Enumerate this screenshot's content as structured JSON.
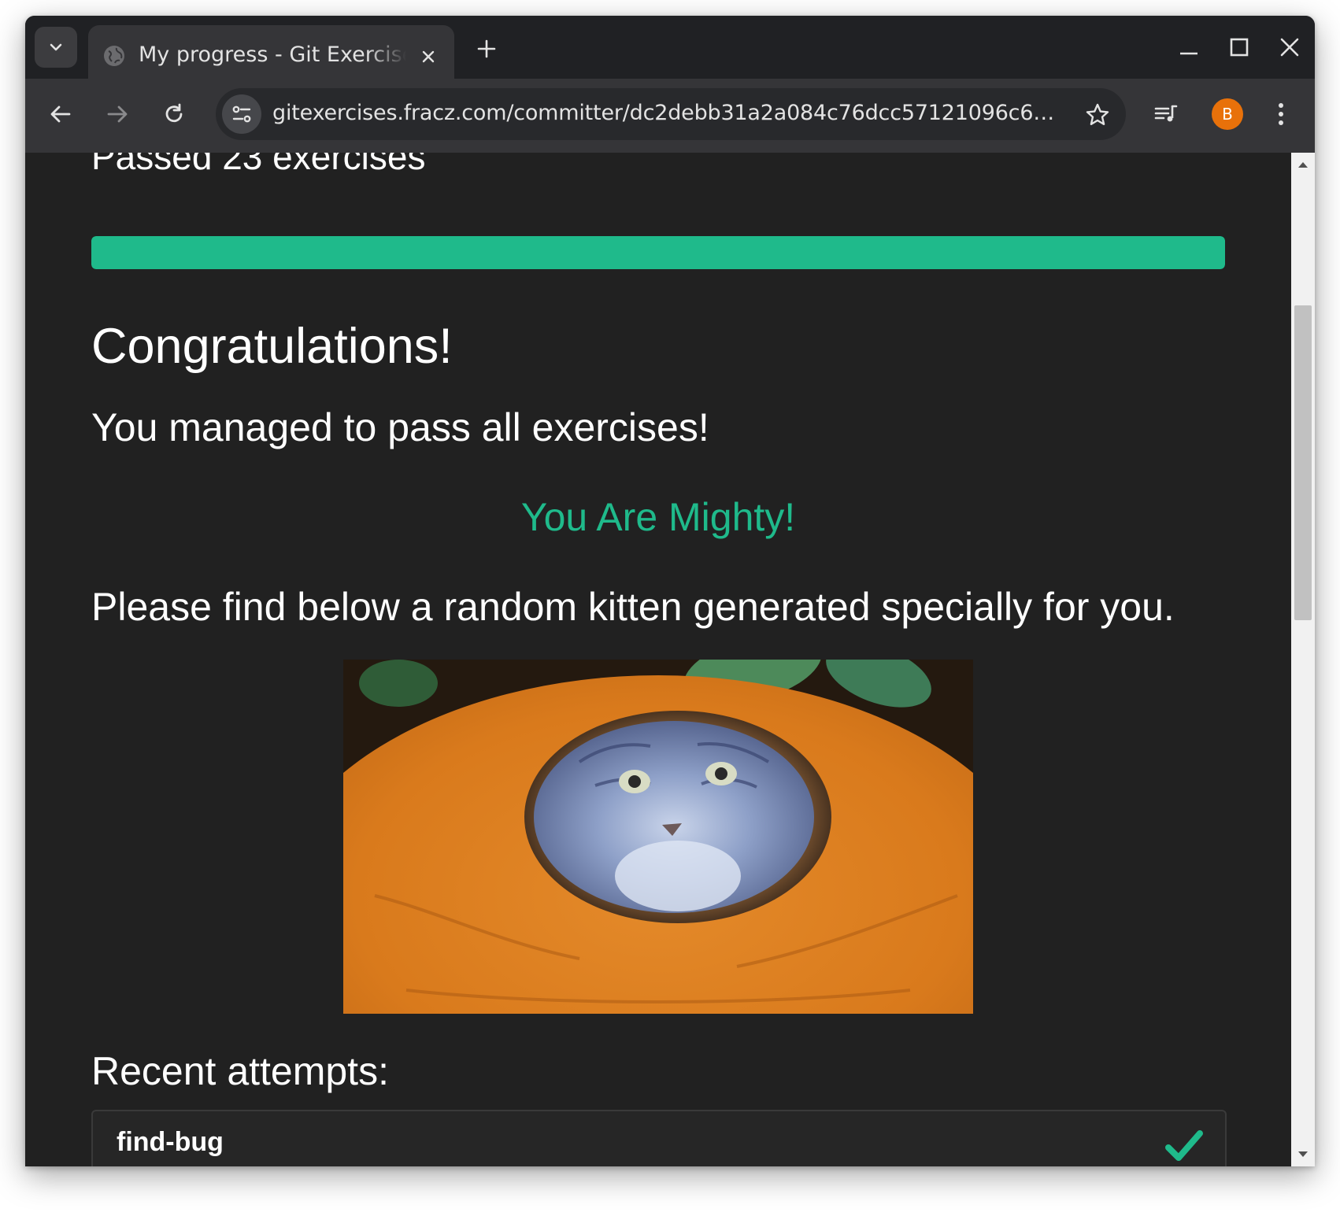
{
  "browser": {
    "tab_title": "My progress - Git Exercises",
    "url": "gitexercises.fracz.com/committer/dc2debb31a2a084c76dcc57121096c6708...",
    "profile_initial": "B"
  },
  "page": {
    "passed_text": "Passed 23 exercises",
    "progress_percent": 100,
    "congrats_title": "Congratulations!",
    "managed_text": "You managed to pass all exercises!",
    "mighty_text": "You Are Mighty!",
    "kitten_text": "Please find below a random kitten generated specially for you.",
    "recent_title": "Recent attempts:",
    "attempts": [
      {
        "name": "find-bug",
        "status": "passed"
      }
    ]
  },
  "colors": {
    "accent": "#1fba8b",
    "background": "#212121",
    "chrome": "#202124",
    "toolbar": "#353538",
    "profile": "#e8710a"
  },
  "icons": [
    "tab-search-icon",
    "globe-icon",
    "close-icon",
    "plus-icon",
    "minimize-icon",
    "maximize-icon",
    "back-arrow-icon",
    "forward-arrow-icon",
    "reload-icon",
    "tune-icon",
    "star-icon",
    "media-queue-icon",
    "kebab-menu-icon",
    "checkmark-icon"
  ]
}
